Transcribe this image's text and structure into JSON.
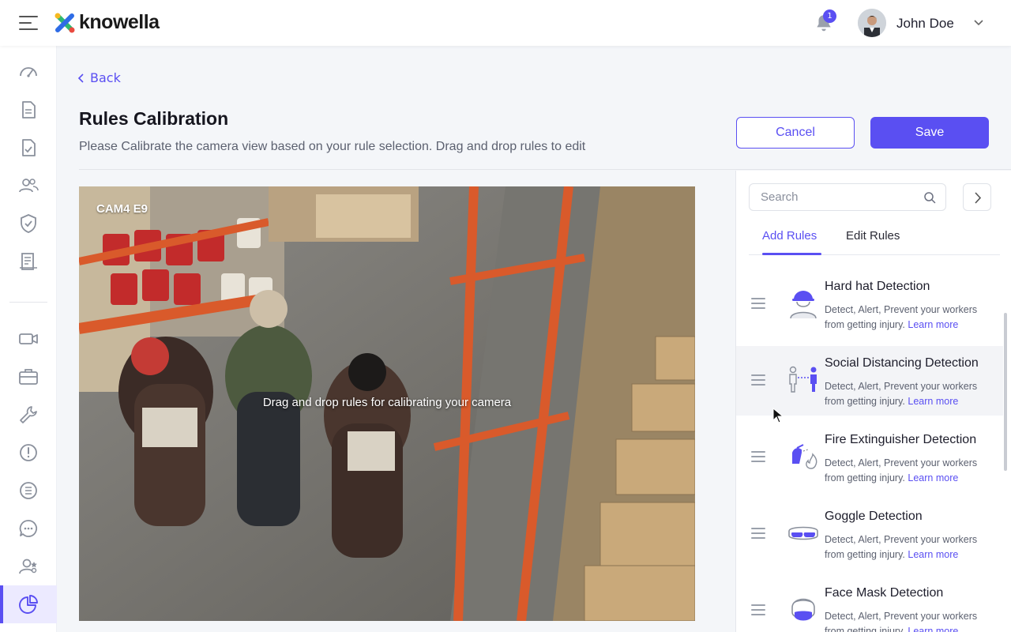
{
  "header": {
    "brand": "knowella",
    "notification_count": "1",
    "user_name": "John Doe"
  },
  "sidebar": {
    "items": [
      {
        "icon": "dashboard-icon"
      },
      {
        "icon": "document-icon"
      },
      {
        "icon": "checklist-icon"
      },
      {
        "icon": "users-icon"
      },
      {
        "icon": "shield-check-icon"
      },
      {
        "icon": "reports-icon"
      },
      {
        "icon": "video-camera-icon"
      },
      {
        "icon": "briefcase-icon"
      },
      {
        "icon": "wrench-icon"
      },
      {
        "icon": "alert-icon"
      },
      {
        "icon": "list-icon"
      },
      {
        "icon": "chat-icon"
      },
      {
        "icon": "user-settings-icon"
      },
      {
        "icon": "pie-chart-icon",
        "active": true
      }
    ]
  },
  "page": {
    "back_label": "Back",
    "title": "Rules Calibration",
    "subtitle": "Please Calibrate the camera view based on your rule selection. Drag and drop rules to edit",
    "cancel_label": "Cancel",
    "save_label": "Save"
  },
  "camera": {
    "label": "CAM4  E9",
    "hint": "Drag and drop rules for calibrating your camera"
  },
  "panel": {
    "search_placeholder": "Search",
    "tabs": [
      {
        "label": "Add Rules",
        "active": true
      },
      {
        "label": "Edit Rules",
        "active": false
      }
    ],
    "rules": [
      {
        "title": "Hard hat Detection",
        "desc": "Detect, Alert, Prevent your workers from getting injury.",
        "link": "Learn more",
        "icon": "hard-hat-icon"
      },
      {
        "title": "Social Distancing Detection",
        "desc": "Detect, Alert, Prevent your workers from getting injury.",
        "link": "Learn more",
        "icon": "social-distancing-icon"
      },
      {
        "title": "Fire Extinguisher Detection",
        "desc": "Detect, Alert, Prevent your workers from getting injury.",
        "link": "Learn more",
        "icon": "fire-extinguisher-icon"
      },
      {
        "title": "Goggle Detection",
        "desc": "Detect, Alert, Prevent your workers from getting injury.",
        "link": "Learn more",
        "icon": "goggle-icon"
      },
      {
        "title": "Face Mask Detection",
        "desc": "Detect, Alert, Prevent your workers from getting injury.",
        "link": "Learn more",
        "icon": "face-mask-icon"
      }
    ]
  },
  "colors": {
    "accent": "#5a4ff2",
    "background": "#f4f6f9"
  }
}
